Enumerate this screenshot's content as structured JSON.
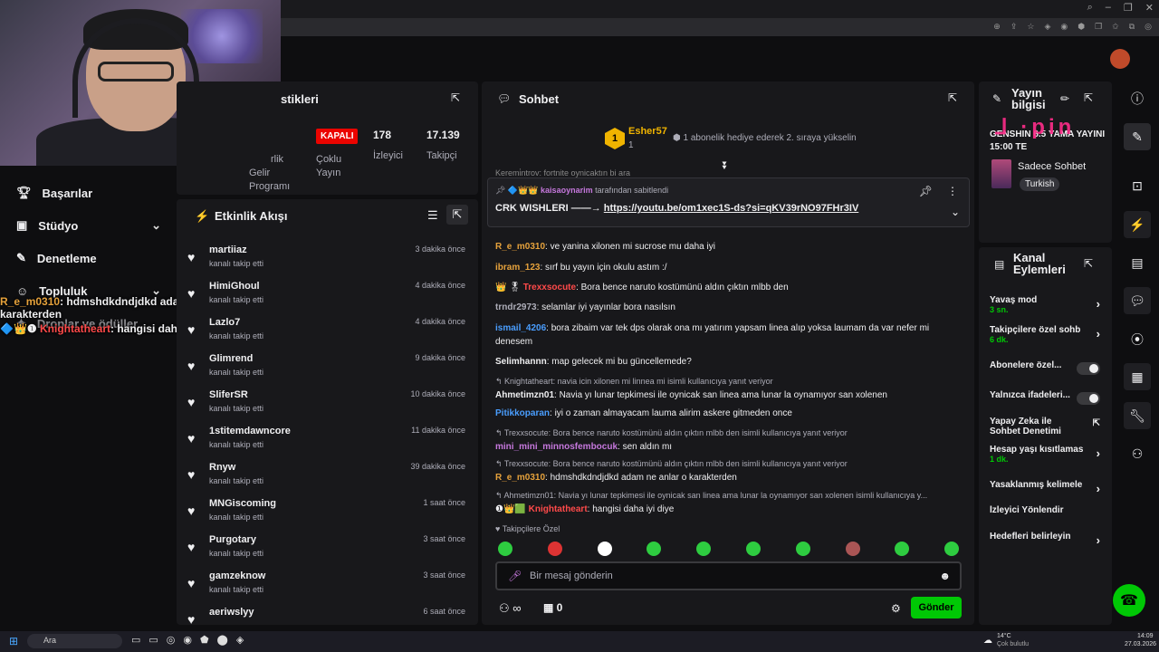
{
  "window": {
    "controls": [
      "–",
      "❐",
      "✕"
    ]
  },
  "sidebar": {
    "items": [
      {
        "label": "Başarılar"
      },
      {
        "label": "Stüdyo"
      },
      {
        "label": "Denetleme"
      },
      {
        "label": "Topluluk"
      },
      {
        "label": "Droplar ve ödüller"
      }
    ]
  },
  "overlay_chat": [
    {
      "user": "R_e_m0310",
      "text": ": hdmshdkdndjdkd adam ne anlar o karakterden"
    },
    {
      "user": "Knightatheart",
      "text": ": hangisi daha iyi diye"
    }
  ],
  "stats": {
    "title": "stikleri",
    "status": "KAPALI",
    "viewers": "178",
    "viewers_label": "İzleyici",
    "followers": "17.139",
    "followers_label": "Takipçi",
    "col1a": "rlik",
    "col1b": "Gelir",
    "col1c": "Programı",
    "col2a": "Çoklu",
    "col2b": "Yayın"
  },
  "activity": {
    "title": "Etkinlik Akışı",
    "items": [
      {
        "name": "martiiaz",
        "sub": "kanalı takip etti",
        "time": "3 dakika önce"
      },
      {
        "name": "HimiGhoul",
        "sub": "kanalı takip etti",
        "time": "4 dakika önce"
      },
      {
        "name": "Lazlo7",
        "sub": "kanalı takip etti",
        "time": "4 dakika önce"
      },
      {
        "name": "Glimrend",
        "sub": "kanalı takip etti",
        "time": "9 dakika önce"
      },
      {
        "name": "SliferSR",
        "sub": "kanalı takip etti",
        "time": "10 dakika önce"
      },
      {
        "name": "1stitemdawncore",
        "sub": "kanalı takip etti",
        "time": "11 dakika önce"
      },
      {
        "name": "Rnyw",
        "sub": "kanalı takip etti",
        "time": "39 dakika önce"
      },
      {
        "name": "MNGiscoming",
        "sub": "kanalı takip etti",
        "time": "1 saat önce"
      },
      {
        "name": "Purgotary",
        "sub": "kanalı takip etti",
        "time": "3 saat önce"
      },
      {
        "name": "gamzeknow",
        "sub": "kanalı takip etti",
        "time": "3 saat önce"
      },
      {
        "name": "aeriwslyy",
        "sub": "",
        "time": "6 saat önce"
      }
    ]
  },
  "chat": {
    "title": "Sohbet",
    "top_user": "Esher57",
    "top_count": "1",
    "gift_text": "1 abonelik hediye ederek 2. sıraya yükselin",
    "cut_line": "Keremi̇ntrov: fortnite oynicaktın bi ara",
    "pinned": {
      "by": "kaisaoynarim",
      "by_suffix": "tarafından sabitlendi",
      "text": "CRK WISHLERI ——→",
      "link": "https://youtu.be/om1xec1S-ds?si=qKV39rNO97FHr3IV"
    },
    "messages": [
      {
        "user": "R_e_m0310",
        "color": "#e6a23c",
        "text": ": ve yanina xilonen mi sucrose mu daha iyi",
        "reply": ""
      },
      {
        "user": "ibram_123",
        "color": "#e6a23c",
        "text": ": sırf bu yayın için okulu astım :/",
        "reply": ""
      },
      {
        "user": "Trexxsocute",
        "color": "#ff4a4a",
        "text": ": Bora bence naruto kostümünü aldın çıktın mlbb den",
        "reply": ""
      },
      {
        "user": "trndr2973",
        "color": "#adadb8",
        "text": ": selamlar iyi yayınlar bora nasılsın",
        "reply": ""
      },
      {
        "user": "ismail_4206",
        "color": "#4a9eff",
        "text": ": bora zibaim var tek dps olarak ona mı yatırım yapsam linea alıp yoksa laumam da var nefer mi denesem",
        "reply": ""
      },
      {
        "user": "Selimhannn",
        "color": "#efeff1",
        "text": ": map gelecek mi bu güncellemede?",
        "reply": ""
      },
      {
        "user": "Ahmetimzn01",
        "color": "#efeff1",
        "text": ": Navia yı lunar tepkimesi ile oynicak san linea ama lunar la oynamıyor san xolenen",
        "reply": "Knightatheart: navia icin xilonen mi linnea mi isimli kullanıcıya yanıt veriyor"
      },
      {
        "user": "Pitikkoparan",
        "color": "#4a9eff",
        "text": ": iyi o zaman almayacam lauma alirim askere gitmeden once",
        "reply": ""
      },
      {
        "user": "mini_mini_minnosfembocuk",
        "color": "#c678dd",
        "text": ": sen aldın mı",
        "reply": "Trexxsocute: Bora bence naruto kostümünü aldın çıktın mlbb den isimli kullanıcıya yanıt veriyor"
      },
      {
        "user": "R_e_m0310",
        "color": "#e6a23c",
        "text": ": hdmshdkdndjdkd adam ne anlar o karakterden",
        "reply": "Trexxsocute: Bora bence naruto kostümünü aldın çıktın mlbb den isimli kullanıcıya yanıt veriyor"
      },
      {
        "user": "Knightatheart",
        "color": "#ff4a4a",
        "text": ": hangisi daha iyi diye",
        "reply": "Ahmetimzn01: Navia yı lunar tepkimesi ile oynicak san linea ama lunar la oynamıyor san xolenen isimli kullanıcıya y..."
      }
    ],
    "follower_only": "Takipçilere Özel",
    "input_placeholder": "Bir mesaj gönderin",
    "points": "0",
    "send": "Gönder"
  },
  "info": {
    "title": "Yayın bilgisi",
    "stream_title": "GENSHIN 6.5 YAMA YAYINI 15:00 TE",
    "category": "Sadece Sohbet",
    "tag": "Turkish"
  },
  "actions": {
    "title": "Kanal Eylemleri",
    "items": [
      {
        "label": "Yavaş mod",
        "sub": "3 sn.",
        "kind": "arrow"
      },
      {
        "label": "Takipçilere özel sohb",
        "sub": "6 dk.",
        "kind": "arrow"
      },
      {
        "label": "Abonelere özel...",
        "sub": "",
        "kind": "toggle"
      },
      {
        "label": "Yalnızca ifadeleri...",
        "sub": "",
        "kind": "toggle"
      },
      {
        "label": "Yapay Zeka ile Sohbet Denetimi",
        "sub": "",
        "kind": "ext"
      },
      {
        "label": "Hesap yaşı kısıtlamas",
        "sub": "1 dk.",
        "kind": "arrow"
      },
      {
        "label": "Yasaklanmış kelimele",
        "sub": "",
        "kind": "arrow"
      },
      {
        "label": "İzleyici Yönlendir",
        "sub": "",
        "kind": "none"
      },
      {
        "label": "Hedefleri belirleyin",
        "sub": "",
        "kind": "arrow"
      }
    ]
  },
  "taskbar": {
    "search": "Ara",
    "weather": "14°C",
    "weather_sub": "Çok bulutlu",
    "time": "14:09",
    "date": "27.03.2026"
  },
  "colors": {
    "accent": "#00c805",
    "live_red": "#eb0400"
  }
}
